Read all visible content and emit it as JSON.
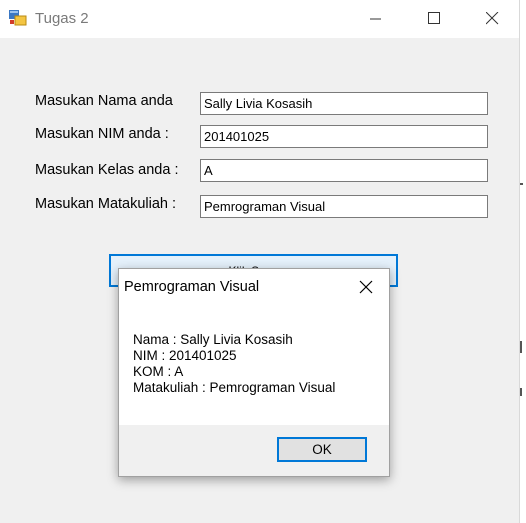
{
  "window": {
    "title": "Tugas 2",
    "icon": "winforms-app-icon",
    "controls": [
      "minimize-icon",
      "maximize-icon",
      "close-icon"
    ]
  },
  "form": {
    "fields": [
      {
        "label": "Masukan Nama anda",
        "value": "Sally Livia Kosasih"
      },
      {
        "label": "Masukan NIM anda :",
        "value": "201401025"
      },
      {
        "label": "Masukan Kelas anda :",
        "value": "A"
      },
      {
        "label": "Masukan Matakuliah :",
        "value": "Pemrograman Visual"
      }
    ],
    "button_label": "Klik Saya"
  },
  "dialog": {
    "title": "Pemrograman Visual",
    "lines": [
      "Nama : Sally Livia Kosasih",
      "NIM : 201401025",
      "KOM : A",
      "Matakuliah : Pemrograman Visual"
    ],
    "ok_label": "OK"
  },
  "colors": {
    "accent": "#0078d7",
    "window_bg": "#f0f0f0",
    "titlebar_bg": "#ffffff"
  }
}
